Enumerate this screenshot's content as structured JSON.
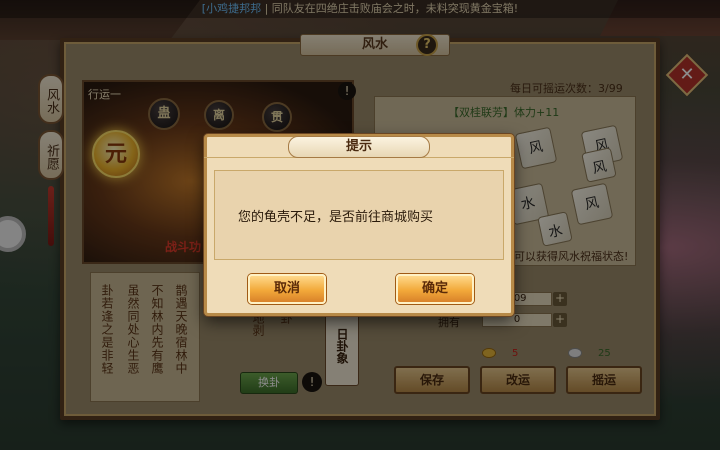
{
  "broadcast": {
    "name": "[小鸡捷邦邦",
    "message": "| 同队友在四绝庄击败庙会之时，未料突现黄金宝箱!"
  },
  "panel": {
    "title": "风水",
    "help_icon": "?",
    "side_tabs": [
      "风水",
      "祈愿"
    ],
    "close_icon": "✕"
  },
  "left": {
    "stage_label": "行运一",
    "orbs": [
      "蛊",
      "离",
      "贯"
    ],
    "main_orb": "元",
    "stage_red_text": "战斗功",
    "info_icon": "!",
    "poem": [
      "卦若逢之是非轻",
      "虽然同处心生恶",
      "不知林内先有鹰",
      "鹊遇天晚宿林中"
    ],
    "mid_text": [
      "地剥",
      "卦"
    ],
    "card_text": "日卦象",
    "change_button": "换卦"
  },
  "right": {
    "daily_count_label": "每日可摇运次数：3/99",
    "pair_label": "【双桂联芳】体力+11",
    "dice": [
      "风",
      "风",
      "水",
      "风",
      "风",
      "水"
    ],
    "wish_status": "可以获得风水祝福状态!",
    "stats": [
      {
        "label": "",
        "value": "209"
      },
      {
        "label": "拥有",
        "value": "0"
      }
    ],
    "cost_gold": "5",
    "cost_silver": "25",
    "buttons": [
      "保存",
      "改运",
      "摇运"
    ]
  },
  "dialog": {
    "title": "提示",
    "message": "您的龟壳不足，是否前往商城购买",
    "cancel": "取消",
    "confirm": "确定"
  }
}
